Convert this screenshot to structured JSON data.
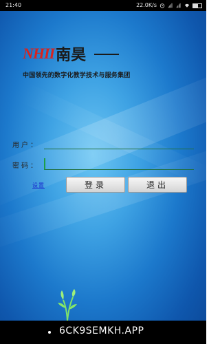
{
  "status_bar": {
    "time": "21:40",
    "network_speed": "22.0K/s"
  },
  "brand": {
    "mark": "NHII",
    "name": "南昊",
    "tagline": "中国领先的数字化教学技术与服务集团"
  },
  "login_form": {
    "username_label": "用户：",
    "username_value": "",
    "password_label": "密码：",
    "password_value": ""
  },
  "actions": {
    "settings_label": "设置",
    "login_label": "登录",
    "exit_label": "退出"
  },
  "nav_bar": {
    "app_label": "6CK9SEMKH.APP"
  },
  "colors": {
    "brand_red": "#d8231e",
    "background_blue": "#1c79cc",
    "link_blue": "#1a2fcf"
  }
}
